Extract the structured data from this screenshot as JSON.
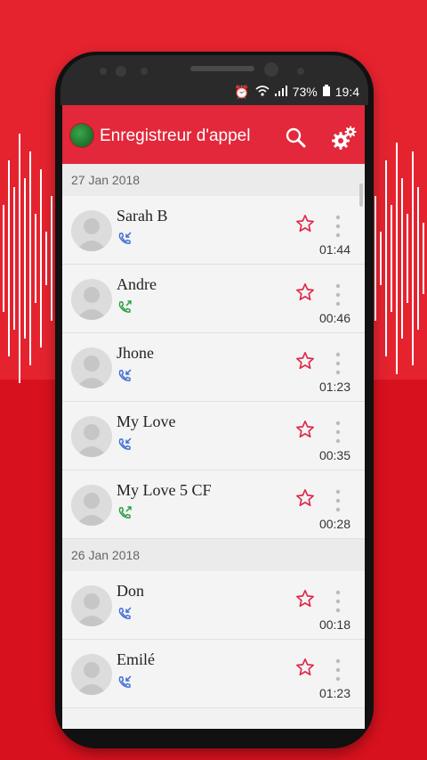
{
  "status_bar": {
    "battery_percent": "73%",
    "time": "19:4"
  },
  "app": {
    "title": "Enregistreur d'appel"
  },
  "sections": [
    {
      "date": "27 Jan 2018",
      "items": [
        {
          "name": "Sarah B",
          "duration": "01:44",
          "call_type": "incoming",
          "icon_color": "#3f6fd6"
        },
        {
          "name": "Andre",
          "duration": "00:46",
          "call_type": "outgoing",
          "icon_color": "#2aa043"
        },
        {
          "name": "Jhone",
          "duration": "01:23",
          "call_type": "incoming",
          "icon_color": "#3f6fd6"
        },
        {
          "name": "My Love",
          "duration": "00:35",
          "call_type": "incoming",
          "icon_color": "#3f6fd6"
        },
        {
          "name": "My Love 5 CF",
          "duration": "00:28",
          "call_type": "outgoing",
          "icon_color": "#2aa043"
        }
      ]
    },
    {
      "date": "26 Jan 2018",
      "items": [
        {
          "name": "Don",
          "duration": "00:18",
          "call_type": "incoming",
          "icon_color": "#3f6fd6"
        },
        {
          "name": "Emilé",
          "duration": "01:23",
          "call_type": "incoming",
          "icon_color": "#3f6fd6"
        }
      ]
    }
  ],
  "colors": {
    "accent": "#e2283a",
    "star": "#e0284a"
  }
}
